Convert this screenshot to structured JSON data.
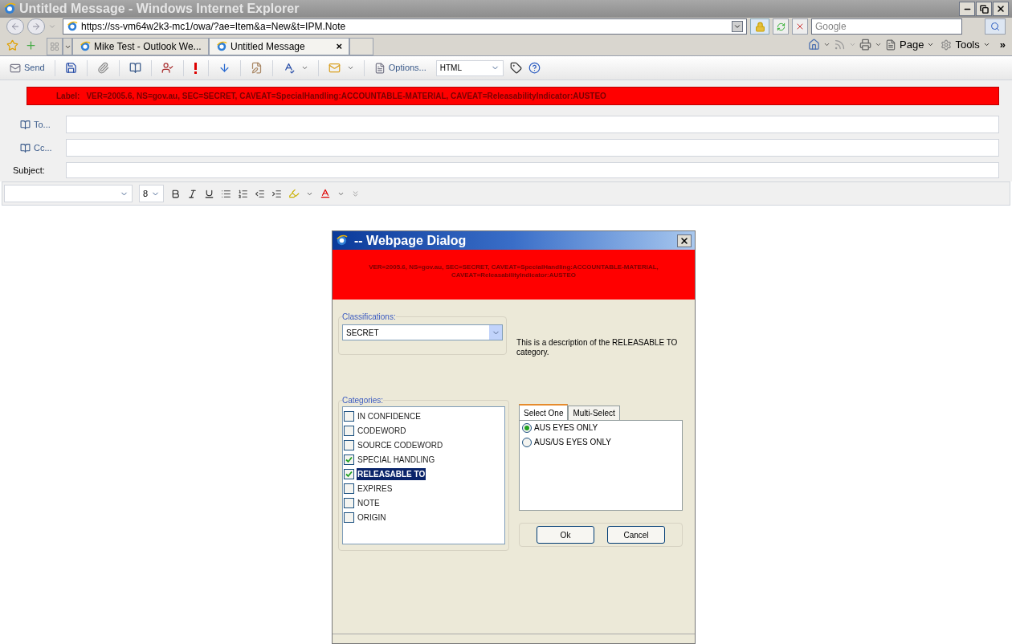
{
  "browser": {
    "title": "Untitled Message - Windows Internet Explorer",
    "address": "https://ss-vm64w2k3-mc1/owa/?ae=Item&a=New&t=IPM.Note",
    "search_placeholder": "Google",
    "tabs": [
      {
        "label": "Mike Test - Outlook We...",
        "selected": false
      },
      {
        "label": "Untitled Message",
        "selected": true
      }
    ],
    "tab_close": "×",
    "commands": [
      "Page",
      "Tools"
    ],
    "more": "»"
  },
  "owa_toolbar": {
    "send": "Send",
    "options": "Options...",
    "format": "HTML"
  },
  "label_bar": {
    "prefix": "Label:",
    "text": "VER=2005.6, NS=gov.au, SEC=SECRET, CAVEAT=SpecialHandling:ACCOUNTABLE-MATERIAL, CAVEAT=ReleasabilityIndicator:AUSTEO"
  },
  "recipients": [
    {
      "label": "To..."
    },
    {
      "label": "Cc..."
    }
  ],
  "subject_label": "Subject:",
  "format_bar": {
    "font_size": "8"
  },
  "dialog": {
    "title": "-- Webpage Dialog",
    "banner": "VER=2005.6, NS=gov.au, SEC=SECRET, CAVEAT=SpecialHandling:ACCOUNTABLE-MATERIAL, CAVEAT=ReleasabilityIndicator:AUSTEO",
    "classifications_label": "Classifications:",
    "classification": "SECRET",
    "description": "This is a description of the RELEASABLE TO category.",
    "categories_label": "Categories:",
    "categories": [
      {
        "label": "IN CONFIDENCE",
        "checked": false,
        "selected": false
      },
      {
        "label": "CODEWORD",
        "checked": false,
        "selected": false
      },
      {
        "label": "SOURCE CODEWORD",
        "checked": false,
        "selected": false
      },
      {
        "label": "SPECIAL HANDLING",
        "checked": true,
        "selected": false
      },
      {
        "label": "RELEASABLE TO",
        "checked": true,
        "selected": true
      },
      {
        "label": "EXPIRES",
        "checked": false,
        "selected": false
      },
      {
        "label": "NOTE",
        "checked": false,
        "selected": false
      },
      {
        "label": "ORIGIN",
        "checked": false,
        "selected": false
      }
    ],
    "tabs": [
      {
        "label": "Select One",
        "selected": true
      },
      {
        "label": "Multi-Select",
        "selected": false
      }
    ],
    "options": [
      {
        "label": "AUS EYES ONLY",
        "selected": true
      },
      {
        "label": "AUS/US EYES ONLY",
        "selected": false
      }
    ],
    "buttons": [
      "Ok",
      "Cancel"
    ]
  }
}
